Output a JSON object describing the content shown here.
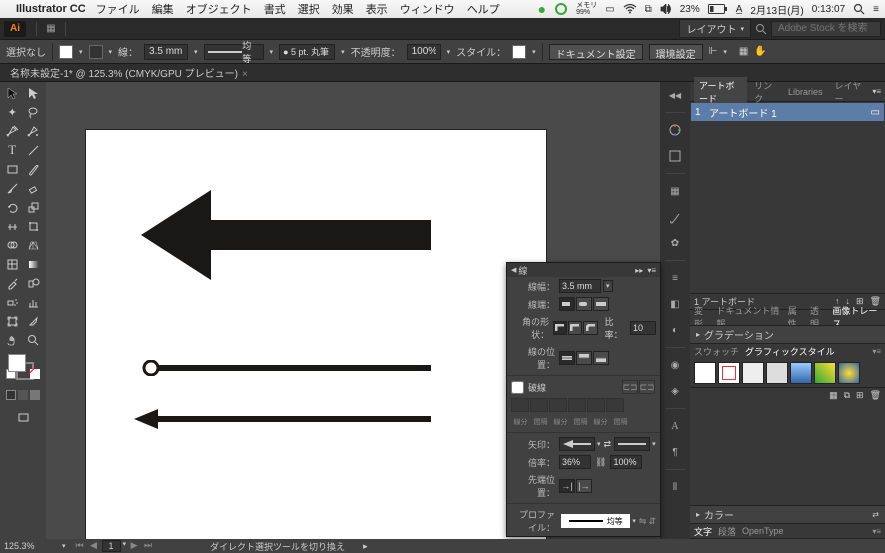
{
  "os_menu": {
    "app_name": "Illustrator CC",
    "items": [
      "ファイル",
      "編集",
      "オブジェクト",
      "書式",
      "選択",
      "効果",
      "表示",
      "ウィンドウ",
      "ヘルプ"
    ],
    "memory": "99%",
    "memory_label": "メモリ",
    "battery": "23%",
    "date": "2月13日(月)",
    "time": "0:13:07"
  },
  "appbar": {
    "logo": "Ai",
    "layout_label": "レイアウト",
    "search_placeholder": "Adobe Stock を検索"
  },
  "control": {
    "selection": "選択なし",
    "stroke_label": "線：",
    "stroke_val": "3.5 mm",
    "uniform": "均等",
    "brush": "5 pt. 丸筆",
    "opacity_label": "不透明度：",
    "opacity": "100%",
    "style_label": "スタイル：",
    "doc_setup": "ドキュメント設定",
    "prefs": "環境設定"
  },
  "tab": {
    "title": "名称未設定-1* @ 125.3% (CMYK/GPU プレビュー)"
  },
  "right": {
    "tabs1": [
      "アートボード",
      "リンク",
      "Libraries",
      "レイヤー"
    ],
    "artboard_num": "1",
    "artboard_name": "アートボード 1",
    "count_label": "1 アートボード",
    "tabs2": [
      "変形",
      "ドキュメント情報",
      "属性",
      "透明",
      "画像トレース"
    ],
    "accordion1": "グラデーション",
    "tabs3": [
      "スウォッチ",
      "グラフィックスタイル"
    ],
    "accordion2": "カラー",
    "tabs4": [
      "文字",
      "段落",
      "OpenType"
    ]
  },
  "stroke": {
    "title": "線",
    "weight_label": "線幅：",
    "weight": "3.5 mm",
    "cap_label": "線端：",
    "corner_label": "角の形状：",
    "ratio_label": "比率：",
    "ratio": "10",
    "align_label": "線の位置：",
    "dashed": "破線",
    "dash_lbls": [
      "線分",
      "間隔",
      "線分",
      "間隔",
      "線分",
      "間隔"
    ],
    "arrow_label": "矢印：",
    "scale_label": "倍率：",
    "scale1": "36%",
    "scale2": "100%",
    "tip_label": "先端位置：",
    "profile_label": "プロファイル：",
    "profile_txt": "均等"
  },
  "status": {
    "zoom": "125.3%",
    "artboard": "1",
    "tool": "ダイレクト選択ツールを切り換え"
  }
}
